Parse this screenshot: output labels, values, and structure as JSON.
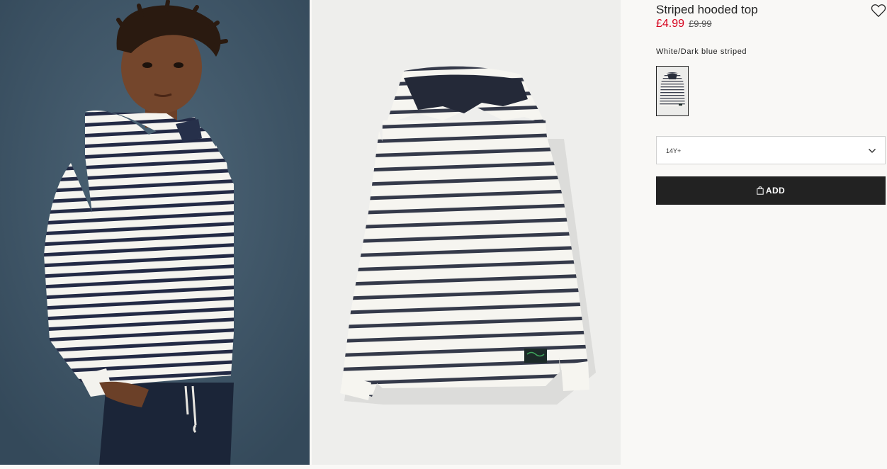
{
  "product": {
    "title": "Striped hooded top",
    "price": "£4.99",
    "old_price": "£9.99",
    "color_name": "White/Dark blue striped"
  },
  "size_select": {
    "value": "14Y+"
  },
  "add_button": {
    "label": "ADD"
  },
  "icons": {
    "favourite": "heart-icon",
    "dropdown": "chevron-down-icon",
    "bag": "shopping-bag-icon"
  },
  "colors": {
    "price_accent": "#d6001c",
    "button_bg": "#222222",
    "page_bg": "#f9f8f6"
  }
}
